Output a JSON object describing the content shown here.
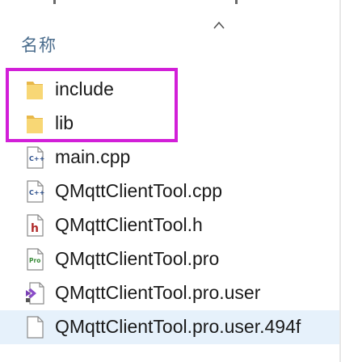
{
  "header": {
    "name_column": "名称"
  },
  "files": [
    {
      "name": "include",
      "icon": "folder-icon"
    },
    {
      "name": "lib",
      "icon": "folder-icon"
    },
    {
      "name": "main.cpp",
      "icon": "cpp-file-icon"
    },
    {
      "name": "QMqttClientTool.cpp",
      "icon": "cpp-file-icon"
    },
    {
      "name": "QMqttClientTool.h",
      "icon": "header-file-icon"
    },
    {
      "name": "QMqttClientTool.pro",
      "icon": "pro-file-icon"
    },
    {
      "name": "QMqttClientTool.pro.user",
      "icon": "visual-studio-file-icon"
    },
    {
      "name": "QMqttClientTool.pro.user.494f",
      "icon": "blank-file-icon"
    }
  ],
  "colors": {
    "highlight": "#d21fd8",
    "folder": "#f8d775",
    "header_text": "#4a6c8c",
    "row_hover": "#e6f1fb"
  }
}
